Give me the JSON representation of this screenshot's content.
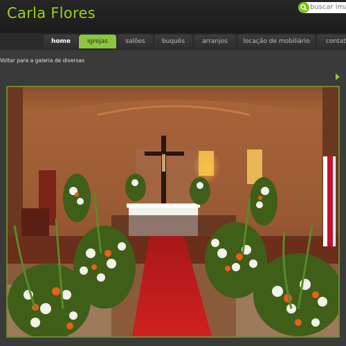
{
  "header": {
    "site_title": "Carla Flores",
    "search_placeholder": "buscar imagem",
    "search_icon": "search-icon"
  },
  "nav": {
    "tabs": [
      {
        "label": "home"
      },
      {
        "label": "igrejas"
      },
      {
        "label": "salões"
      },
      {
        "label": "buquês"
      },
      {
        "label": "arranjos"
      },
      {
        "label": "locação de mobiliário"
      },
      {
        "label": "contato"
      }
    ],
    "active_tab": "igrejas"
  },
  "breadcrumb": {
    "text": "Voltar para a galeria de diversas"
  },
  "colors": {
    "accent": "#8dc63f",
    "title_green": "#9cd21c",
    "background": "#3a3a3a"
  }
}
